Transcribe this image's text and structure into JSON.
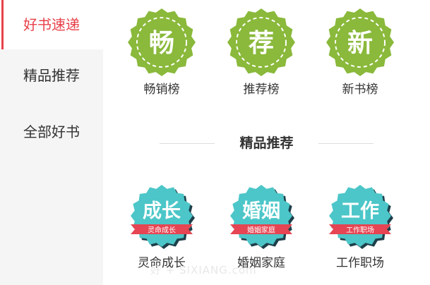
{
  "sidebar": {
    "items": [
      {
        "label": "好书速递",
        "active": true
      },
      {
        "label": "精品推荐",
        "active": false
      },
      {
        "label": "全部好书",
        "active": false
      }
    ]
  },
  "top_badges": [
    {
      "glyph": "畅",
      "label": "畅销榜"
    },
    {
      "glyph": "荐",
      "label": "推荐榜"
    },
    {
      "glyph": "新",
      "label": "新书榜"
    }
  ],
  "section": {
    "title": "精品推荐"
  },
  "category_badges": [
    {
      "title": "成长",
      "ribbon": "灵命成长",
      "label": "灵命成长"
    },
    {
      "title": "婚姻",
      "ribbon": "婚姻家庭",
      "label": "婚姻家庭"
    },
    {
      "title": "工作",
      "ribbon": "工作职场",
      "label": "工作职场"
    }
  ],
  "watermark": "好 + SIXIANG.com",
  "colors": {
    "accent": "#e8414a",
    "badge_green": "#8ab93b",
    "badge_teal": "#4cc6c8",
    "ribbon_red": "#e64553",
    "sidebar_bg": "#f5f5f5"
  }
}
